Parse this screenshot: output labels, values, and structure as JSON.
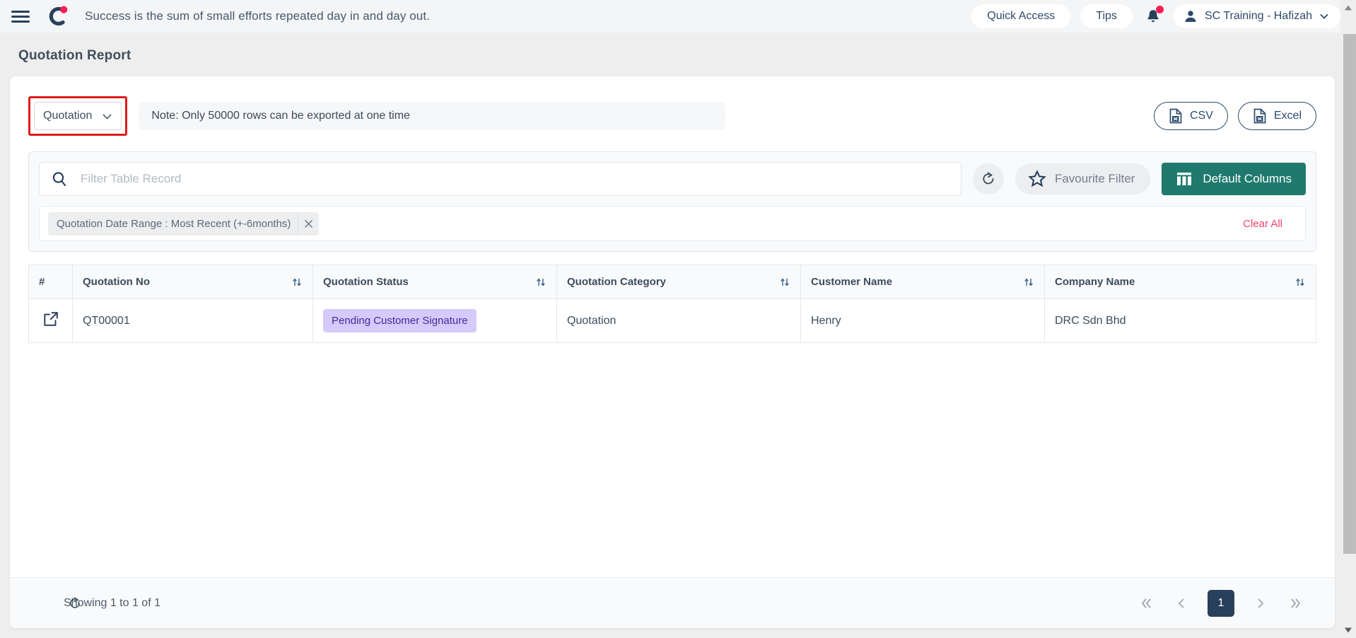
{
  "topbar": {
    "menu_icon": "hamburger-icon",
    "logo_icon": "brand-logo-icon",
    "motto": "Success is the sum of small efforts repeated day in and day out.",
    "quick_access_label": "Quick Access",
    "tips_label": "Tips",
    "notification_icon": "bell-icon",
    "has_notification_dot": true,
    "user_name": "SC Training - Hafizah",
    "avatar_icon": "user-icon",
    "chevron_icon": "chevron-down-icon"
  },
  "page": {
    "title": "Quotation Report"
  },
  "export": {
    "type_select_value": "Quotation",
    "type_select_icon": "chevron-down-icon",
    "type_select_highlighted": true,
    "highlight_color": "#e01b1b",
    "note": "Note: Only 50000 rows can be exported at one time",
    "csv_label": "CSV",
    "csv_icon": "file-csv-icon",
    "excel_label": "Excel",
    "excel_icon": "file-excel-icon"
  },
  "filters": {
    "search_placeholder": "Filter Table Record",
    "search_value": "",
    "search_icon": "search-icon",
    "refresh_icon": "refresh-icon",
    "favourite_filter_label": "Favourite Filter",
    "favourite_filter_icon": "star-icon",
    "default_columns_label": "Default Columns",
    "default_columns_icon": "columns-icon",
    "default_columns_color": "#1f7a6d",
    "chips": [
      {
        "label": "Quotation Date Range : Most Recent (+-6months)",
        "remove_icon": "close-icon"
      }
    ],
    "clear_all_label": "Clear All",
    "clear_all_color": "#f5426c"
  },
  "table": {
    "sort_icon": "sort-updown-icon",
    "columns": [
      {
        "label": "#",
        "sortable": false
      },
      {
        "label": "Quotation No",
        "sortable": true
      },
      {
        "label": "Quotation Status",
        "sortable": true
      },
      {
        "label": "Quotation Category",
        "sortable": true
      },
      {
        "label": "Customer Name",
        "sortable": true
      },
      {
        "label": "Company Name",
        "sortable": true
      }
    ],
    "rows": [
      {
        "open_icon": "external-link-icon",
        "quotation_no": "QT00001",
        "quotation_status": "Pending Customer Signature",
        "status_bg": "#d6c9fb",
        "status_fg": "#3c2e96",
        "quotation_category": "Quotation",
        "customer_name": "Henry",
        "company_name": "DRC Sdn Bhd"
      }
    ]
  },
  "footer": {
    "refresh_icon": "refresh-icon",
    "showing_text": "Showing 1 to 1 of 1",
    "first_icon": "chevron-double-left-icon",
    "prev_icon": "chevron-left-icon",
    "current_page": "1",
    "next_icon": "chevron-right-icon",
    "last_icon": "chevron-double-right-icon"
  },
  "scrollbar": {
    "up_icon": "triangle-up-icon",
    "down_icon": "triangle-down-icon"
  }
}
